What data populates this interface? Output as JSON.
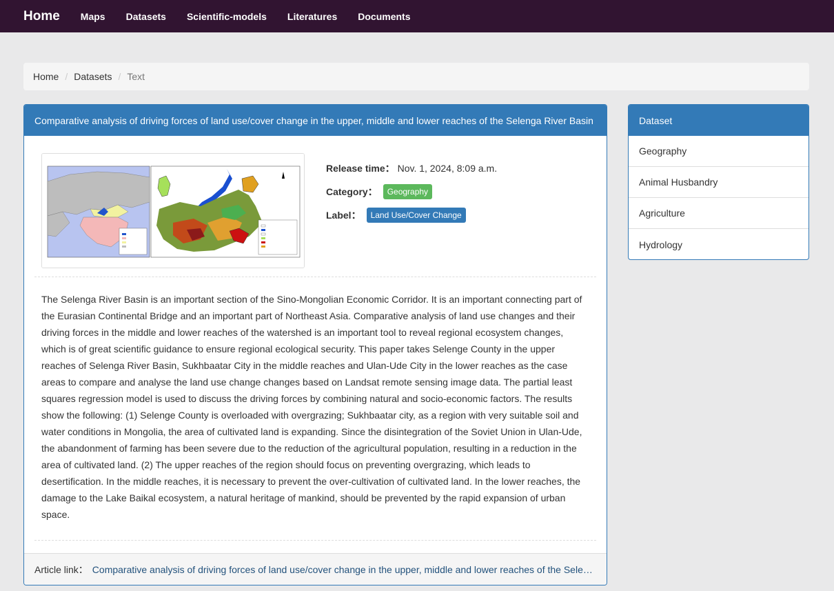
{
  "nav": {
    "brand": "Home",
    "items": [
      "Maps",
      "Datasets",
      "Scientific-models",
      "Literatures",
      "Documents"
    ]
  },
  "breadcrumb": {
    "home": "Home",
    "sep": "/",
    "datasets": "Datasets",
    "current": "Text"
  },
  "article": {
    "title": "Comparative analysis of driving forces of land use/cover change in the upper, middle and lower reaches of the Selenga River Basin",
    "release_label": "Release time：",
    "release_value": "Nov. 1, 2024, 8:09 a.m.",
    "category_label": "Category：",
    "category_value": "Geography",
    "label_label": "Label：",
    "label_value": "Land Use/Cover Change",
    "abstract": "The Selenga River Basin is an important section of the Sino-Mongolian Economic Corridor. It is an important connecting part of the Eurasian Continental Bridge and an important part of Northeast Asia. Comparative analysis of land use changes and their driving forces in the middle and lower reaches of the watershed is an important tool to reveal regional ecosystem changes, which is of great scientific guidance to ensure regional ecological security. This paper takes Selenge County in the upper reaches of Selenga River Basin, Sukhbaatar City in the middle reaches and Ulan-Ude City in the lower reaches as the case areas to compare and analyse the land use change changes based on Landsat remote sensing image data. The partial least squares regression model is used to discuss the driving forces by combining natural and socio-economic factors. The results show the following: (1) Selenge County is overloaded with overgrazing; Sukhbaatar city, as a region with very suitable soil and water conditions in Mongolia, the area of cultivated land is expanding. Since the disintegration of the Soviet Union in Ulan-Ude, the abandonment of farming has been severe due to the reduction of the agricultural population, resulting in a reduction in the area of cultivated land. (2) The upper reaches of the region should focus on preventing overgrazing, which leads to desertification. In the middle reaches, it is necessary to prevent the over-cultivation of cultivated land. In the lower reaches, the damage to the Lake Baikal ecosystem, a natural heritage of mankind, should be prevented by the rapid expansion of urban space.",
    "link_label": "Article link：",
    "link_text": "Comparative analysis of driving forces of land use/cover change in the upper, middle and lower reaches of the Selenga River Basin"
  },
  "sidebar": {
    "heading": "Dataset",
    "items": [
      "Geography",
      "Animal Husbandry",
      "Agriculture",
      "Hydrology"
    ]
  },
  "colors": {
    "navbar": "#311431",
    "primary": "#337ab7",
    "success": "#5cb85c"
  }
}
